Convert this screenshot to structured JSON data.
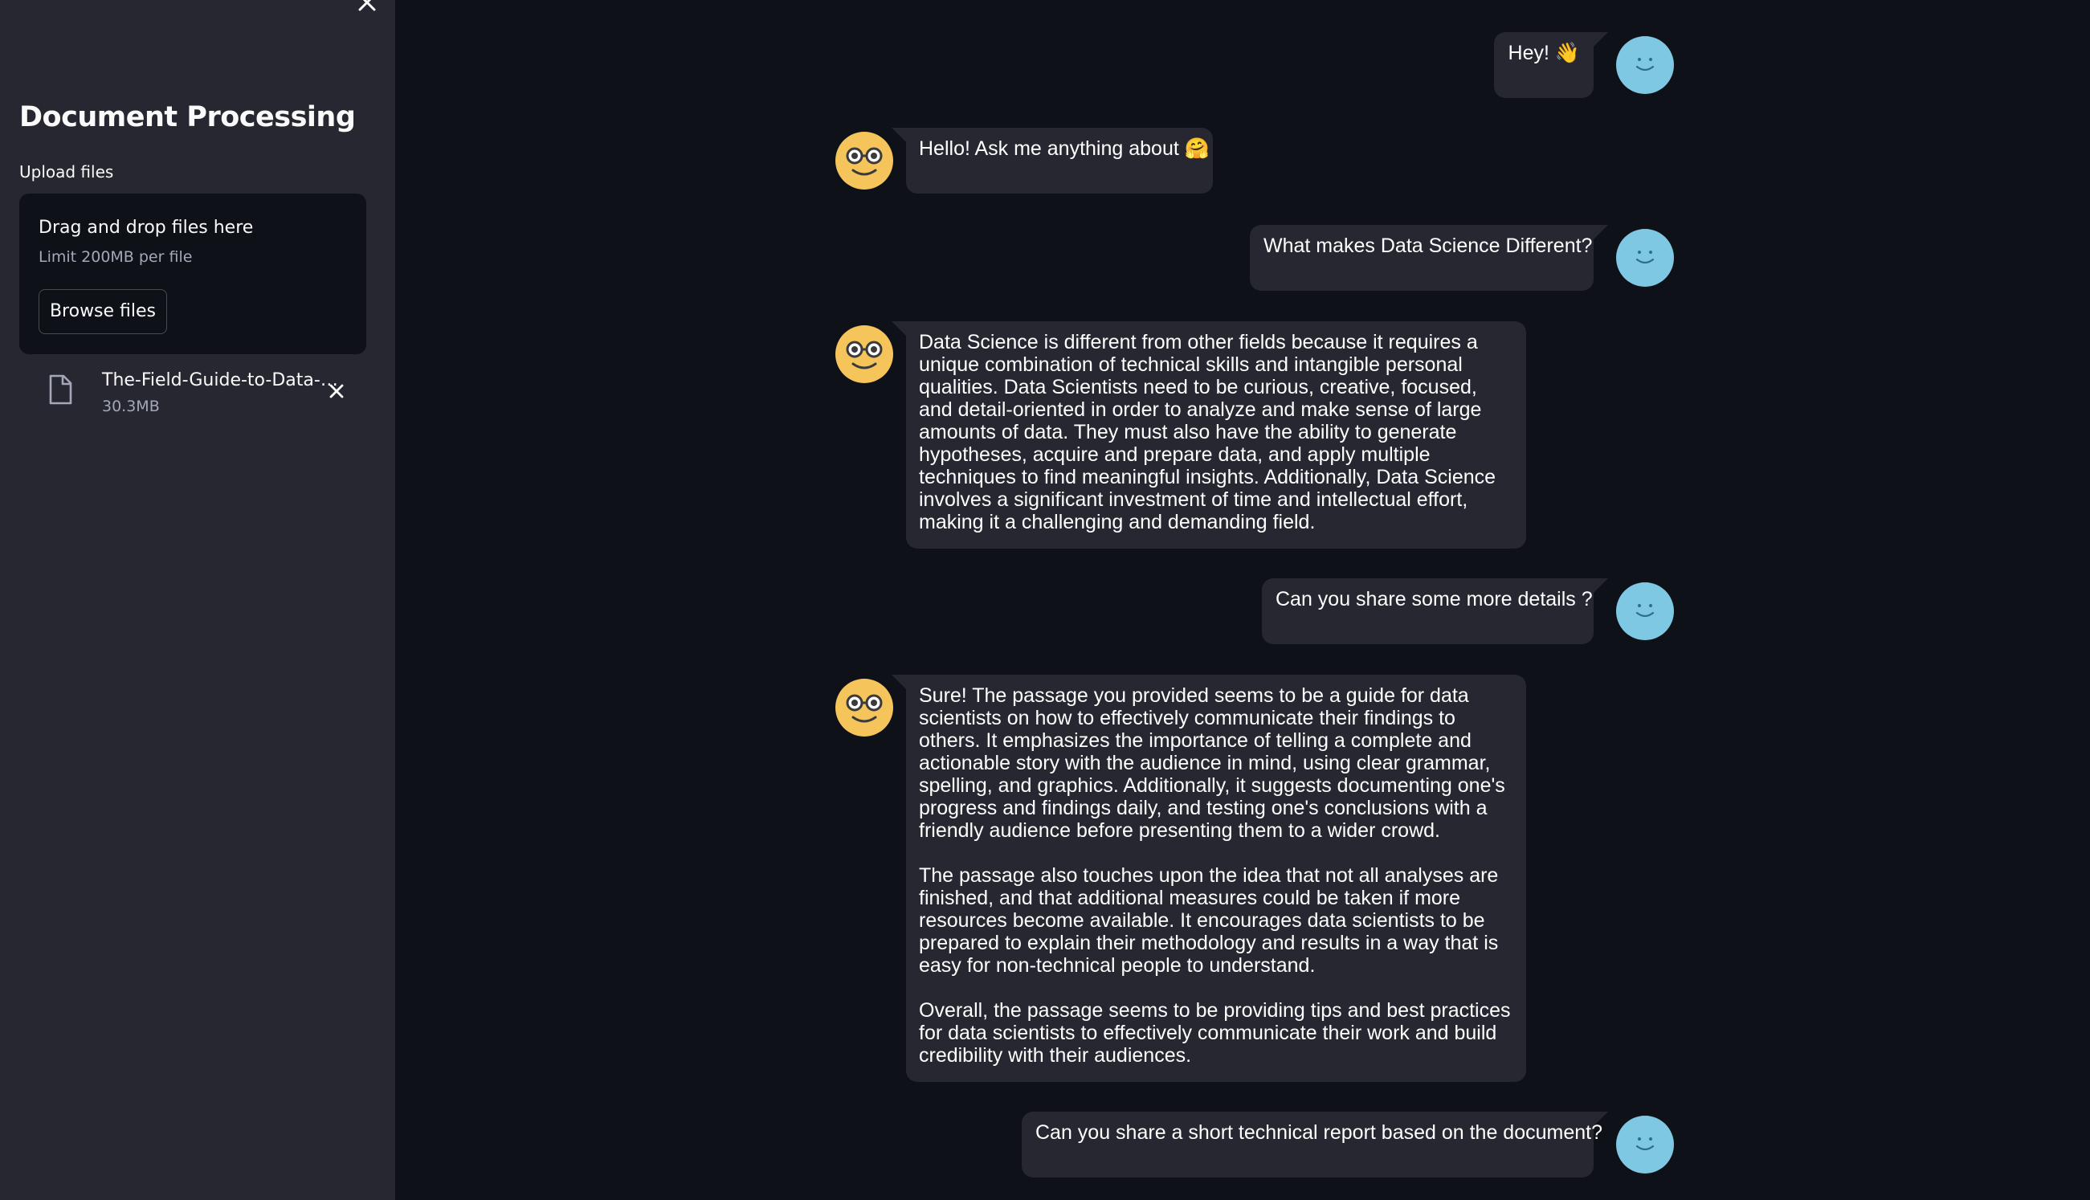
{
  "sidebar": {
    "title": "Document Processing",
    "upload_label": "Upload files",
    "dropzone": {
      "title": "Drag and drop files here",
      "limit": "Limit 200MB per file",
      "browse_label": "Browse files"
    },
    "file": {
      "name": "The-Field-Guide-to-Data-…",
      "size": "30.3MB"
    }
  },
  "chat": {
    "messages": [
      {
        "role": "user",
        "text": "Hey! 👋"
      },
      {
        "role": "assistant",
        "text": "Hello! Ask me anything about 🤗"
      },
      {
        "role": "user",
        "text": "What makes Data Science Different?"
      },
      {
        "role": "assistant",
        "paragraphs": [
          "Data Science is different from other fields because it requires a unique combination of technical skills and intangible personal qualities. Data Scientists need to be curious, creative, focused, and detail-oriented in order to analyze and make sense of large amounts of data. They must also have the ability to generate hypotheses, acquire and prepare data, and apply multiple techniques to find meaningful insights. Additionally, Data Science involves a significant investment of time and intellectual effort, making it a challenging and demanding field."
        ]
      },
      {
        "role": "user",
        "text": "Can you share some more details ?"
      },
      {
        "role": "assistant",
        "paragraphs": [
          "Sure! The passage you provided seems to be a guide for data scientists on how to effectively communicate their findings to others. It emphasizes the importance of telling a complete and actionable story with the audience in mind, using clear grammar, spelling, and graphics. Additionally, it suggests documenting one's progress and findings daily, and testing one's conclusions with a friendly audience before presenting them to a wider crowd.",
          "The passage also touches upon the idea that not all analyses are finished, and that additional measures could be taken if more resources become available. It encourages data scientists to be prepared to explain their methodology and results in a way that is easy for non-technical people to understand.",
          "Overall, the passage seems to be providing tips and best practices for data scientists to effectively communicate their work and build credibility with their audiences."
        ]
      },
      {
        "role": "user",
        "text": "Can you share a short technical report based on the document?"
      }
    ]
  },
  "icons": {
    "sidebar_close": "close-icon",
    "file": "file-icon",
    "file_remove": "close-icon",
    "user_avatar": "smiley-avatar-icon",
    "bot_avatar": "nerd-face-avatar-icon"
  },
  "colors": {
    "app_background": "#0e1117",
    "sidebar_background": "#262730",
    "bubble_background": "#262730",
    "user_avatar": "#7ec8e3",
    "bot_avatar": "#f5c45a"
  }
}
